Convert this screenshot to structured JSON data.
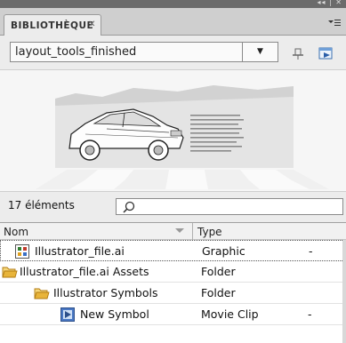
{
  "panel": {
    "tab_title": "BIBLIOTHÈQUE",
    "window_controls": "◂◂ | ✕",
    "tab_close": "✕",
    "menu_icon": "panel-menu-icon"
  },
  "document_selector": {
    "value": "layout_tools_finished",
    "arrow": "▼"
  },
  "search": {
    "count_label": "17 éléments",
    "placeholder": ""
  },
  "list": {
    "headers": {
      "name": "Nom",
      "type": "Type"
    },
    "rows": [
      {
        "name": "Illustrator_file.ai",
        "type": "Graphic",
        "extra": "-",
        "icon": "graphic-symbol-icon"
      },
      {
        "name": "Illustrator_file.ai Assets",
        "type": "Folder",
        "extra": "",
        "icon": "folder-icon"
      },
      {
        "name": "Illustrator Symbols",
        "type": "Folder",
        "extra": "",
        "icon": "folder-icon"
      },
      {
        "name": "New Symbol",
        "type": "Movie Clip",
        "extra": "-",
        "icon": "movie-clip-icon"
      }
    ]
  },
  "colors": {
    "folder": "#e8b43a",
    "movieclip": "#4a78c4"
  }
}
